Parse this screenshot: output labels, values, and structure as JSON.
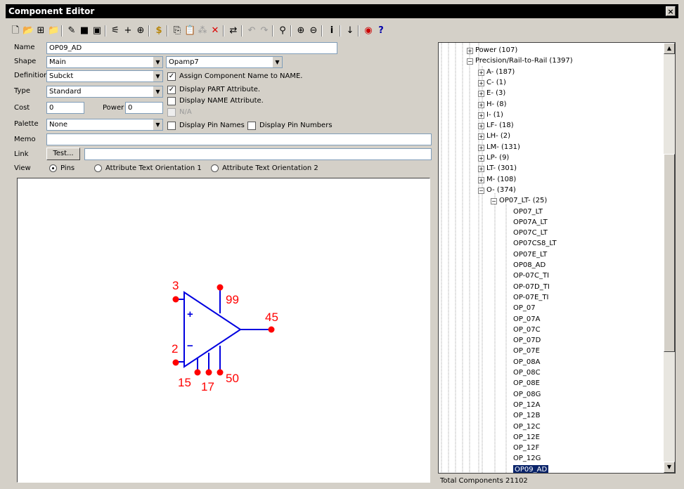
{
  "window": {
    "title": "Component Editor",
    "close_label": "×"
  },
  "toolbar": {
    "icons": [
      "new-icon",
      "open-icon",
      "tree-icon",
      "folder-icon",
      "wand-icon",
      "save-icon",
      "save-as-icon",
      "pin-tool-icon",
      "add-pin-icon",
      "pin-grid-icon",
      "dollar-icon",
      "copy-icon",
      "paste-icon",
      "duplicate-icon",
      "delete-icon",
      "replace-icon",
      "undo-icon",
      "redo-icon",
      "find-icon",
      "zoom-in-icon",
      "zoom-out-icon",
      "info-icon",
      "sort-icon",
      "stop-icon",
      "help-icon"
    ]
  },
  "form": {
    "name_label": "Name",
    "name_value": "OP09_AD",
    "shape_label": "Shape",
    "shape_value": "Main",
    "shape2_value": "Opamp7",
    "definition_label": "Definition",
    "definition_value": "Subckt",
    "type_label": "Type",
    "type_value": "Standard",
    "cost_label": "Cost",
    "cost_value": "0",
    "power_label": "Power",
    "power_value": "0",
    "palette_label": "Palette",
    "palette_value": "None",
    "memo_label": "Memo",
    "memo_value": "",
    "link_label": "Link",
    "test_button": "Test...",
    "link_value": "",
    "view_label": "View",
    "assign_name": "Assign Component Name to NAME.",
    "display_part": "Display PART Attribute.",
    "display_name": "Display NAME Attribute.",
    "na": "N/A",
    "display_pin_names": "Display Pin Names",
    "display_pin_numbers": "Display Pin Numbers",
    "view_pins": "Pins",
    "view_orient1": "Attribute Text Orientation 1",
    "view_orient2": "Attribute Text Orientation 2"
  },
  "symbol": {
    "pins": [
      "3",
      "99",
      "45",
      "2",
      "15",
      "17",
      "50"
    ],
    "plus": "+",
    "minus": "−"
  },
  "tree": {
    "items": [
      {
        "label": "Power (107)",
        "sign": "+"
      },
      {
        "label": "Precision/Rail-to-Rail (1397)",
        "sign": "−"
      },
      {
        "label": "A- (187)",
        "sign": "+"
      },
      {
        "label": "C- (1)",
        "sign": "+"
      },
      {
        "label": "E- (3)",
        "sign": "+"
      },
      {
        "label": "H- (8)",
        "sign": "+"
      },
      {
        "label": "I- (1)",
        "sign": "+"
      },
      {
        "label": "LF- (18)",
        "sign": "+"
      },
      {
        "label": "LH- (2)",
        "sign": "+"
      },
      {
        "label": "LM- (131)",
        "sign": "+"
      },
      {
        "label": "LP- (9)",
        "sign": "+"
      },
      {
        "label": "LT- (301)",
        "sign": "+"
      },
      {
        "label": "M- (108)",
        "sign": "+"
      },
      {
        "label": "O- (374)",
        "sign": "−"
      },
      {
        "label": "OP07_LT- (25)",
        "sign": "−"
      },
      {
        "label": "OP07_LT"
      },
      {
        "label": "OP07A_LT"
      },
      {
        "label": "OP07C_LT"
      },
      {
        "label": "OP07CS8_LT"
      },
      {
        "label": "OP07E_LT"
      },
      {
        "label": "OP08_AD"
      },
      {
        "label": "OP-07C_TI"
      },
      {
        "label": "OP-07D_TI"
      },
      {
        "label": "OP-07E_TI"
      },
      {
        "label": "OP_07"
      },
      {
        "label": "OP_07A"
      },
      {
        "label": "OP_07C"
      },
      {
        "label": "OP_07D"
      },
      {
        "label": "OP_07E"
      },
      {
        "label": "OP_08A"
      },
      {
        "label": "OP_08C"
      },
      {
        "label": "OP_08E"
      },
      {
        "label": "OP_08G"
      },
      {
        "label": "OP_12A"
      },
      {
        "label": "OP_12B"
      },
      {
        "label": "OP_12C"
      },
      {
        "label": "OP_12E"
      },
      {
        "label": "OP_12F"
      },
      {
        "label": "OP_12G"
      },
      {
        "label": "OP09_AD",
        "selected": true
      }
    ]
  },
  "status": {
    "text": "Total Components 21102"
  }
}
